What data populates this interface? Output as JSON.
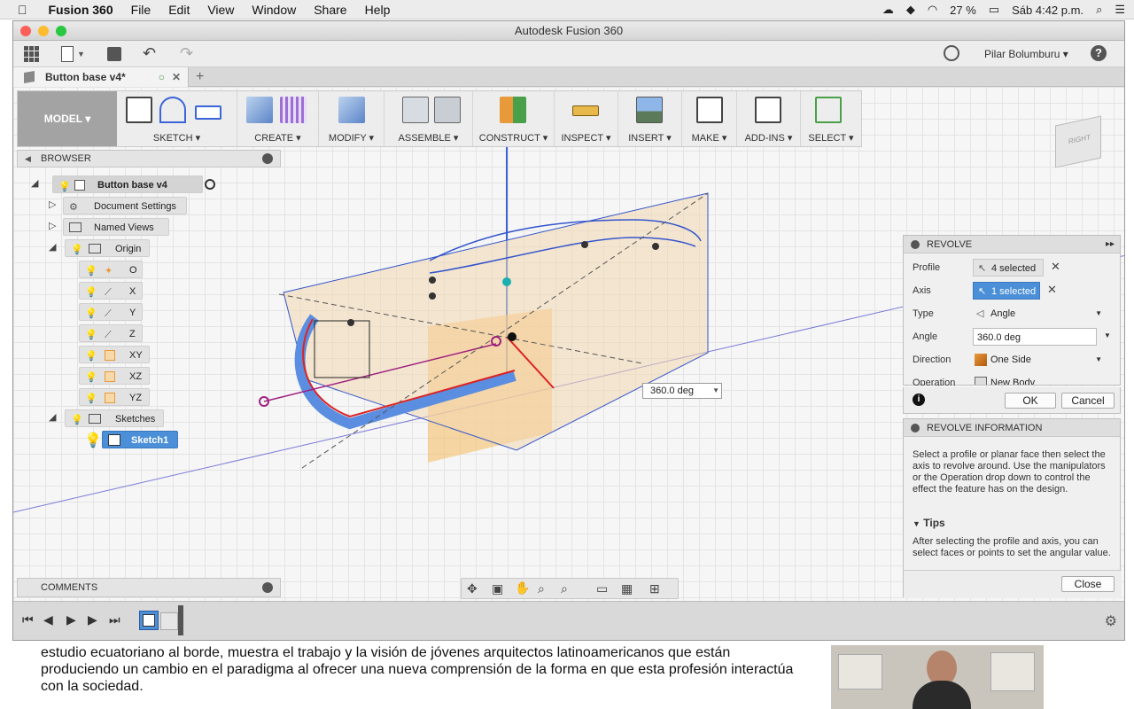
{
  "menubar": {
    "app_name": "Fusion 360",
    "items": [
      "File",
      "Edit",
      "View",
      "Window",
      "Share",
      "Help"
    ],
    "battery": "27 %",
    "clock": "Sáb 4:42 p.m."
  },
  "window": {
    "title": "Autodesk Fusion 360",
    "user": "Pilar Bolumburu",
    "document_tab": "Button base v4*"
  },
  "toolbar": {
    "workspace": "MODEL",
    "groups": [
      "SKETCH",
      "CREATE",
      "MODIFY",
      "ASSEMBLE",
      "CONSTRUCT",
      "INSPECT",
      "INSERT",
      "MAKE",
      "ADD-INS",
      "SELECT"
    ]
  },
  "browser": {
    "title": "BROWSER",
    "root": "Button base v4",
    "document_settings": "Document Settings",
    "named_views": "Named Views",
    "origin": "Origin",
    "origin_items": [
      "O",
      "X",
      "Y",
      "Z",
      "XY",
      "XZ",
      "YZ"
    ],
    "sketches": "Sketches",
    "sketch1": "Sketch1"
  },
  "comments": {
    "title": "COMMENTS"
  },
  "viewcube": {
    "face": "RIGHT"
  },
  "canvas": {
    "angle_value": "360.0 deg"
  },
  "revolve": {
    "title": "REVOLVE",
    "rows": [
      {
        "label": "Profile",
        "value": "4 selected"
      },
      {
        "label": "Axis",
        "value": "1 selected"
      },
      {
        "label": "Type",
        "value": "Angle"
      },
      {
        "label": "Angle",
        "value": "360.0 deg"
      },
      {
        "label": "Direction",
        "value": "One Side"
      },
      {
        "label": "Operation",
        "value": "New Body"
      }
    ],
    "ok": "OK",
    "cancel": "Cancel"
  },
  "revolve_info": {
    "title": "REVOLVE INFORMATION",
    "text": "Select a profile or planar face then select the axis to revolve around. Use the manipulators or the Operation drop down to control the effect the feature has on the design.",
    "tips_title": "Tips",
    "tips_text": "After selecting the profile and axis, you can select faces or points to set the angular value.",
    "close": "Close"
  },
  "background_page": {
    "text": "estudio ecuatoriano al borde, muestra el trabajo y la visión de jóvenes arquitectos latinoamericanos que están produciendo un cambio en el paradigma al ofrecer una nueva comprensión de la forma en que esta profesión interactúa con la sociedad."
  },
  "colors": {
    "accent": "#4a8fd8",
    "profile_blue": "#5b8ee0",
    "plane_orange": "#f5c26b"
  }
}
